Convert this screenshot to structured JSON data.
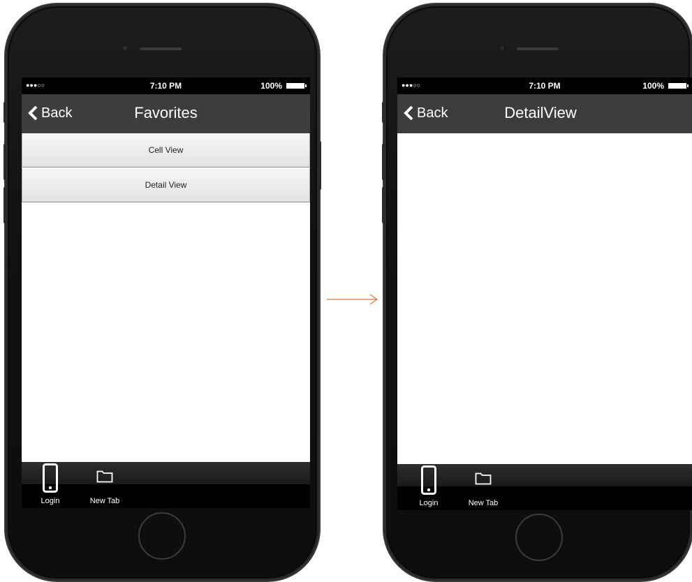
{
  "screens": [
    {
      "status": {
        "signal": "●●●○○",
        "time": "7:10 PM",
        "battery": "100%"
      },
      "navbar": {
        "back_label": "Back",
        "title": "Favorites"
      },
      "cells": [
        "Cell View",
        "Detail View"
      ],
      "tabs": [
        {
          "label": "Login",
          "icon": "phone-icon"
        },
        {
          "label": "New Tab",
          "icon": "folder-icon"
        }
      ]
    },
    {
      "status": {
        "signal": "●●●○○",
        "time": "7:10 PM",
        "battery": "100%"
      },
      "navbar": {
        "back_label": "Back",
        "title": "DetailView"
      },
      "cells": [],
      "tabs": [
        {
          "label": "Login",
          "icon": "phone-icon"
        },
        {
          "label": "New Tab",
          "icon": "folder-icon"
        }
      ]
    }
  ],
  "colors": {
    "navbar": "#3d3d3d",
    "arrow": "#e07a2e",
    "status_bar": "#000000"
  }
}
